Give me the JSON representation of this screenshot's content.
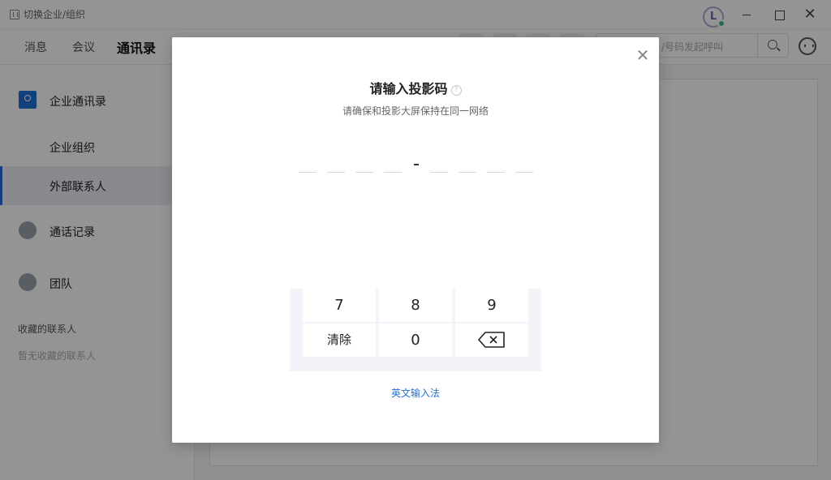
{
  "titlebar": {
    "org_switch_label": "切换企业/组织",
    "avatar_letter": "L"
  },
  "nav": {
    "tabs": [
      {
        "label": "消息"
      },
      {
        "label": "会议"
      },
      {
        "label": "通讯录"
      }
    ],
    "active_tab": "通讯录",
    "search_placeholder": "/号码发起呼叫"
  },
  "sidebar": {
    "items": [
      {
        "label": "企业通讯录",
        "icon": "contacts-book-icon"
      },
      {
        "label": "企业组织"
      },
      {
        "label": "外部联系人"
      },
      {
        "label": "通话记录",
        "icon": "call-record-icon"
      },
      {
        "label": "团队",
        "icon": "team-icon"
      }
    ],
    "favorites_title": "收藏的联系人",
    "favorites_empty": "暂无收藏的联系人"
  },
  "modal": {
    "title": "请输入投影码",
    "subtitle": "请确保和投影大屏保持在同一网络",
    "code_slots": 8,
    "keypad": {
      "row1": [
        "7",
        "8",
        "9"
      ],
      "clear_label": "清除",
      "zero_label": "0",
      "backspace_icon": "backspace-icon"
    },
    "ime_link": "英文输入法",
    "close_icon": "close-icon"
  },
  "colors": {
    "accent": "#1f6fd6",
    "overlay": "rgba(0,0,0,0.42)",
    "keypad_bg": "#f2f3f8",
    "online": "#3ac47d"
  }
}
